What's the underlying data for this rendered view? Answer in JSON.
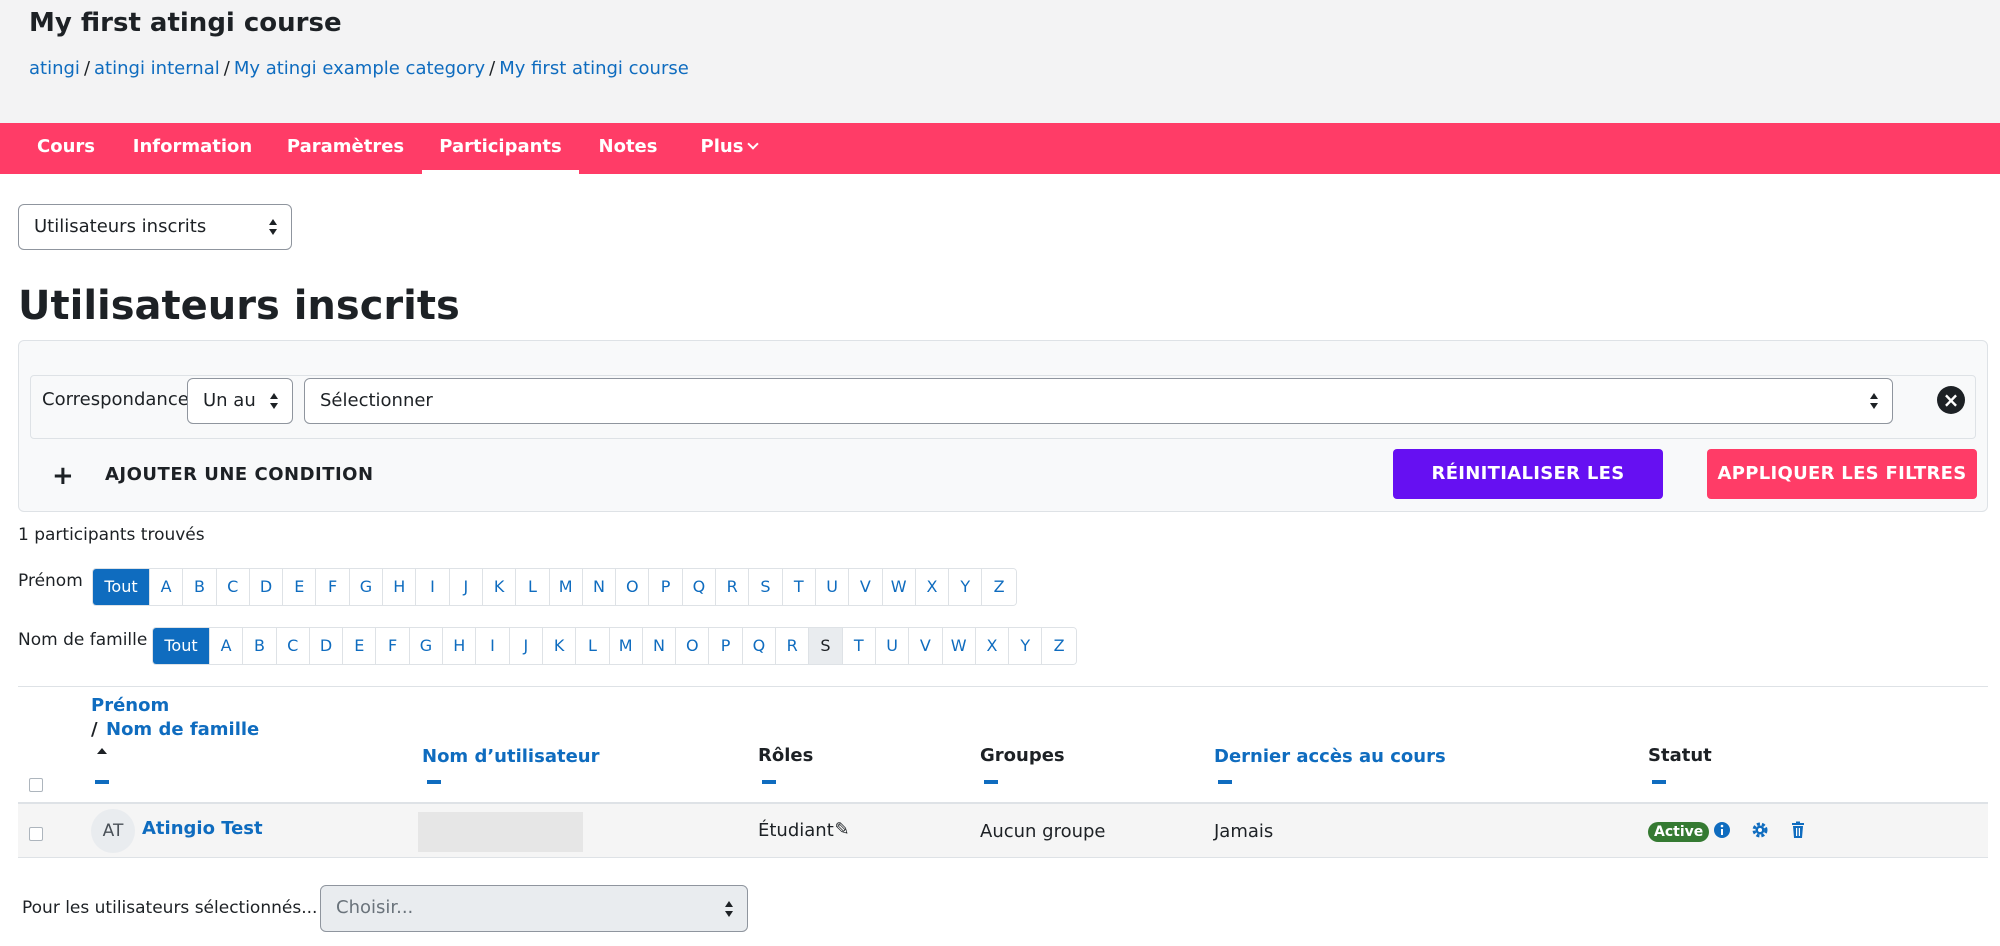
{
  "header": {
    "title": "My first atingi course",
    "breadcrumb": [
      "atingi",
      "atingi internal",
      "My atingi example category",
      "My first atingi course"
    ],
    "separator": "/"
  },
  "nav": {
    "items": [
      "Cours",
      "Information",
      "Paramètres",
      "Participants",
      "Notes",
      "Plus"
    ],
    "active": "Participants",
    "color": "#ff3c67"
  },
  "view_select": {
    "value": "Utilisateurs inscrits"
  },
  "page_heading": "Utilisateurs inscrits",
  "filters": {
    "match_label": "Correspondance",
    "match_value": "Un au",
    "condition_placeholder": "Sélectionner",
    "add_condition": "AJOUTER UNE CONDITION",
    "reset_label": "RÉINITIALISER LES FILTRES",
    "apply_label": "APPLIQUER LES FILTRES",
    "reset_color": "#6610f2",
    "apply_color": "#ff3c67"
  },
  "results": {
    "count_text": "1 participants trouvés"
  },
  "initials": {
    "firstname_label": "Prénom",
    "lastname_label": "Nom de famille",
    "all_label": "Tout",
    "letters": [
      "A",
      "B",
      "C",
      "D",
      "E",
      "F",
      "G",
      "H",
      "I",
      "J",
      "K",
      "L",
      "M",
      "N",
      "O",
      "P",
      "Q",
      "R",
      "S",
      "T",
      "U",
      "V",
      "W",
      "X",
      "Y",
      "Z"
    ],
    "lastname_highlighted": "S"
  },
  "table": {
    "headers": {
      "firstname": "Prénom",
      "slash": "/",
      "lastname": "Nom de famille",
      "username": "Nom d’utilisateur",
      "roles": "Rôles",
      "groups": "Groupes",
      "last_access": "Dernier accès au cours",
      "status": "Statut"
    },
    "rows": [
      {
        "initials": "AT",
        "name": "Atingio Test",
        "role": "Étudiant",
        "groups": "Aucun groupe",
        "last_access": "Jamais",
        "status": "Active"
      }
    ]
  },
  "bulk": {
    "label": "Pour les utilisateurs sélectionnés...",
    "placeholder": "Choisir..."
  }
}
